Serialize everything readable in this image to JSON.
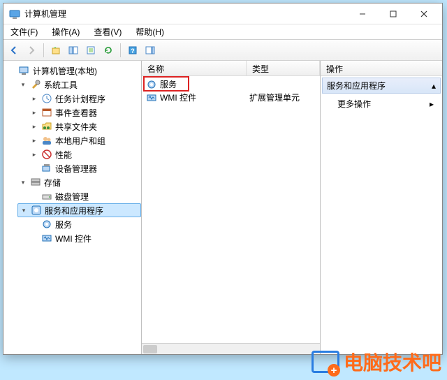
{
  "window": {
    "title": "计算机管理"
  },
  "menu": {
    "file": "文件(F)",
    "action": "操作(A)",
    "view": "查看(V)",
    "help": "帮助(H)"
  },
  "tree": {
    "root": "计算机管理(本地)",
    "system_tools": "系统工具",
    "task_scheduler": "任务计划程序",
    "event_viewer": "事件查看器",
    "shared_folders": "共享文件夹",
    "local_users": "本地用户和组",
    "performance": "性能",
    "device_manager": "设备管理器",
    "storage": "存储",
    "disk_management": "磁盘管理",
    "services_apps": "服务和应用程序",
    "services": "服务",
    "wmi_control": "WMI 控件"
  },
  "list": {
    "col_name": "名称",
    "col_type": "类型",
    "rows": [
      {
        "name": "服务",
        "type": ""
      },
      {
        "name": "WMI 控件",
        "type": "扩展管理单元"
      }
    ]
  },
  "actions": {
    "header": "操作",
    "group": "服务和应用程序",
    "more": "更多操作"
  },
  "watermark": "电脑技术吧"
}
